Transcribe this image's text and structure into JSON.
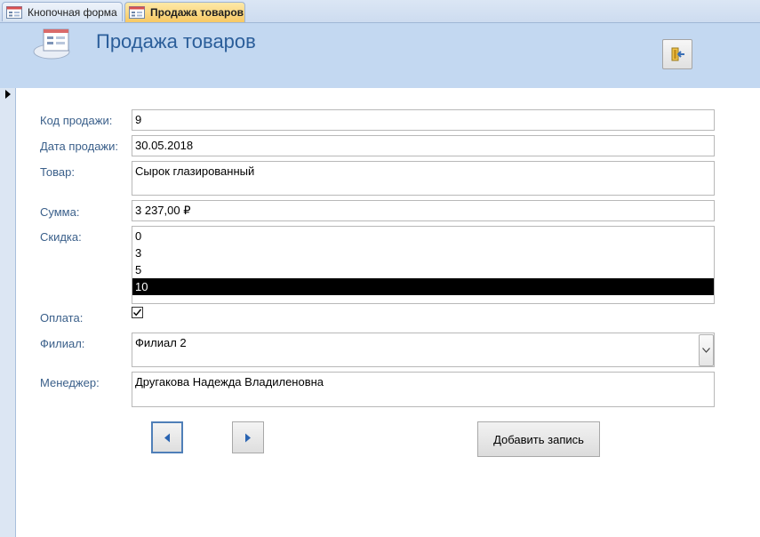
{
  "tabs": [
    {
      "label": "Кнопочная форма",
      "active": false
    },
    {
      "label": "Продажа товаров",
      "active": true
    }
  ],
  "header": {
    "title": "Продажа товаров",
    "background": "#c3d8f1",
    "title_color": "#2b5e9a"
  },
  "fields": {
    "sale_code": {
      "label": "Код продажи:",
      "value": "9"
    },
    "sale_date": {
      "label": "Дата продажи:",
      "value": "30.05.2018"
    },
    "product": {
      "label": "Товар:",
      "value": "Сырок глазированный"
    },
    "amount": {
      "label": "Сумма:",
      "value": "3 237,00 ₽"
    },
    "discount": {
      "label": "Скидка:",
      "options": [
        "0",
        "3",
        "5",
        "10"
      ],
      "selected": "10"
    },
    "payment": {
      "label": "Оплата:",
      "checked": true
    },
    "branch": {
      "label": "Филиал:",
      "value": "Филиал 2"
    },
    "manager": {
      "label": "Менеджер:",
      "value": "Другакова Надежда Владиленовна"
    }
  },
  "buttons": {
    "add_record": "Добавить запись"
  },
  "icons": {
    "tab_form": "form-icon",
    "header_logo": "form-logo-icon",
    "close": "exit-door-icon",
    "prev": "triangle-left-icon",
    "next": "triangle-right-icon",
    "dropdown": "chevron-down-icon",
    "record_selector": "record-pointer-icon"
  }
}
